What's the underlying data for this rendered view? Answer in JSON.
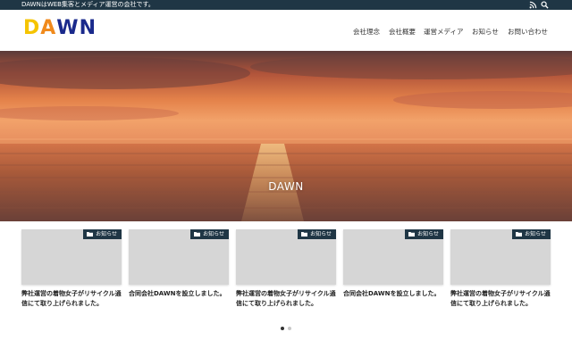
{
  "topbar": {
    "tagline": "DAWNはWEB集客とメディア運営の会社です。",
    "icons": [
      "rss-icon",
      "search-icon"
    ]
  },
  "header": {
    "logo_letters": [
      {
        "char": "D",
        "color": "#f5c400"
      },
      {
        "char": "A",
        "color": "#f08a1c"
      },
      {
        "char": "W",
        "color": "#1a2a8c"
      },
      {
        "char": "N",
        "color": "#1a2a8c"
      }
    ],
    "nav": [
      "会社理念",
      "会社概要",
      "運営メディア",
      "お知らせ",
      "お問い合わせ"
    ]
  },
  "hero": {
    "title": "DAWN"
  },
  "cards": [
    {
      "badge": "お知らせ",
      "title": "弊社運営の着物女子がリサイクル通信にて取り上げられました。"
    },
    {
      "badge": "お知らせ",
      "title": "合同会社DAWNを設立しました。"
    },
    {
      "badge": "お知らせ",
      "title": "弊社運営の着物女子がリサイクル通信にて取り上げられました。"
    },
    {
      "badge": "お知らせ",
      "title": "合同会社DAWNを設立しました。"
    },
    {
      "badge": "お知らせ",
      "title": "弊社運営の着物女子がリサイクル通信にて取り上げられました。"
    }
  ],
  "carousel": {
    "active_index": 0,
    "total": 2
  },
  "colors": {
    "primary": "#1f3645",
    "thumb": "#d6d6d6"
  }
}
